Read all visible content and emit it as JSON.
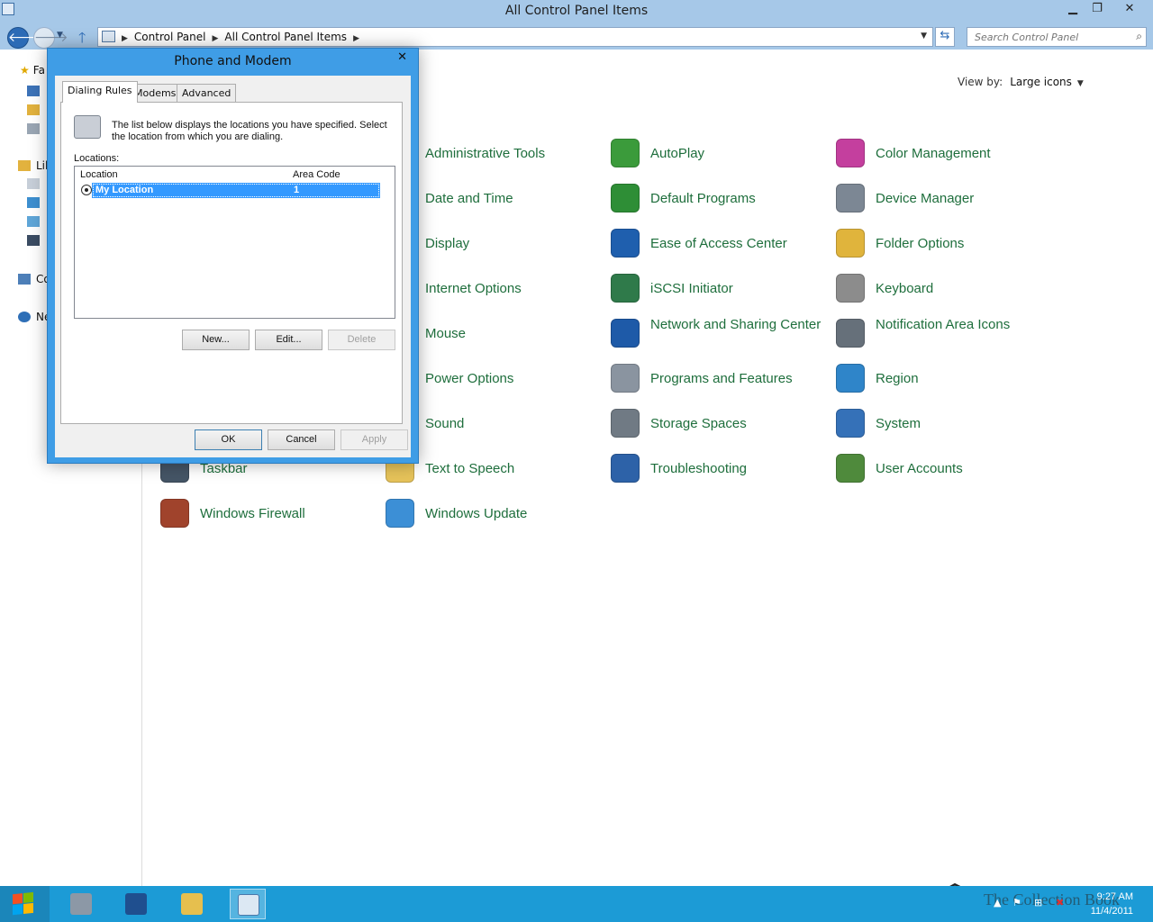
{
  "window": {
    "title": "All Control Panel Items",
    "controls": {
      "minimize": "▁",
      "maximize": "❐",
      "close": "✕"
    }
  },
  "nav": {
    "breadcrumbs": [
      "Control Panel",
      "All Control Panel Items"
    ],
    "search_placeholder": "Search Control Panel"
  },
  "navpane": {
    "items": [
      {
        "label": "Fa",
        "icon": "star-icon"
      },
      {
        "label": "Lil",
        "icon": "library-icon"
      },
      {
        "label": "Co",
        "icon": "computer-icon"
      },
      {
        "label": "Ne",
        "icon": "network-icon"
      }
    ]
  },
  "view": {
    "label": "View by:",
    "value": "Large icons"
  },
  "items": [
    {
      "label": "Administrative Tools",
      "color": "#6b7d93"
    },
    {
      "label": "AutoPlay",
      "color": "#3b9b3b"
    },
    {
      "label": "Color Management",
      "color": "#c43f9e"
    },
    {
      "label": "Date and Time",
      "color": "#5d7fb0"
    },
    {
      "label": "Default Programs",
      "color": "#2e8e36"
    },
    {
      "label": "Device Manager",
      "color": "#7c8794"
    },
    {
      "label": "Display",
      "color": "#3a6fbf"
    },
    {
      "label": "Ease of Access Center",
      "color": "#1f5fae"
    },
    {
      "label": "Folder Options",
      "color": "#e0b43c"
    },
    {
      "label": "Internet Options",
      "color": "#2d8ad4"
    },
    {
      "label": "iSCSI Initiator",
      "color": "#2f7a4a"
    },
    {
      "label": "Keyboard",
      "color": "#8c8c8c"
    },
    {
      "label": "Mouse",
      "color": "#b0b8c2"
    },
    {
      "label": "Network and Sharing Center",
      "color": "#1e5aa8"
    },
    {
      "label": "Notification Area Icons",
      "color": "#66707a"
    },
    {
      "label": "Power Options",
      "color": "#3d9140"
    },
    {
      "label": "Programs and Features",
      "color": "#8a94a0"
    },
    {
      "label": "Region",
      "color": "#2f85c9"
    },
    {
      "label": "Sound",
      "color": "#8f9aa6"
    },
    {
      "label": "Storage Spaces",
      "color": "#707a84"
    },
    {
      "label": "System",
      "color": "#3571b8"
    },
    {
      "label": "Taskbar",
      "color": "#455566"
    },
    {
      "label": "Text to Speech",
      "color": "#e6c35a"
    },
    {
      "label": "Troubleshooting",
      "color": "#2d62a8"
    },
    {
      "label": "User Accounts",
      "color": "#4f8a3c"
    },
    {
      "label": "Windows Firewall",
      "color": "#a0432c"
    },
    {
      "label": "Windows Update",
      "color": "#3c8fd6"
    }
  ],
  "dialog": {
    "title": "Phone and Modem",
    "close": "✕",
    "tabs": [
      "Dialing Rules",
      "Modems",
      "Advanced"
    ],
    "intro": "The list below displays the locations you have specified. Select the location from which you are dialing.",
    "locations_label": "Locations:",
    "columns": [
      "Location",
      "Area Code"
    ],
    "rows": [
      {
        "location": "My Location",
        "area_code": "1"
      }
    ],
    "buttons": {
      "new": "New...",
      "edit": "Edit...",
      "delete": "Delete"
    },
    "footer": {
      "ok": "OK",
      "cancel": "Cancel",
      "apply": "Apply"
    }
  },
  "taskbar": {
    "time": "9:27 AM",
    "date": "11/4/2011",
    "watermark": "The Collection Book"
  }
}
